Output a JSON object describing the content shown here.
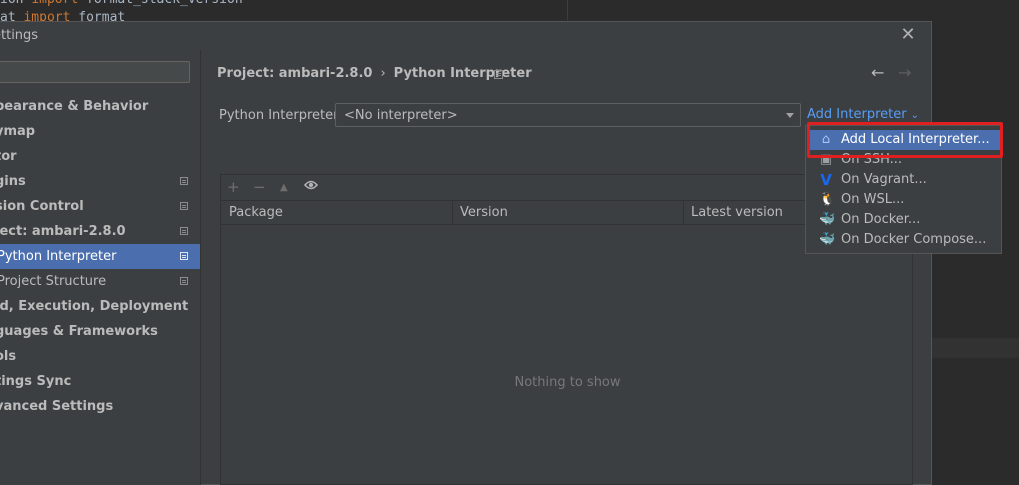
{
  "editor": {
    "line1": {
      "kw": "import",
      "pre": "ion ",
      "post": " format_stack_version"
    },
    "line2": {
      "kw": "import",
      "pre": "at ",
      "post": " format"
    }
  },
  "dialog": {
    "title": "ettings",
    "close_glyph": "✕"
  },
  "sidebar": {
    "items": [
      {
        "label": "pearance & Behavior",
        "bold": true,
        "doc": false
      },
      {
        "label": "ymap",
        "bold": true,
        "doc": false
      },
      {
        "label": "tor",
        "bold": true,
        "doc": false
      },
      {
        "label": "gins",
        "bold": true,
        "doc": true
      },
      {
        "label": "sion Control",
        "bold": true,
        "doc": true
      },
      {
        "label": "ject: ambari-2.8.0",
        "bold": true,
        "doc": true
      },
      {
        "label": "Python Interpreter",
        "bold": false,
        "doc": true,
        "selected": true
      },
      {
        "label": "Project Structure",
        "bold": false,
        "doc": true
      },
      {
        "label": "ld, Execution, Deployment",
        "bold": true,
        "doc": false
      },
      {
        "label": "guages & Frameworks",
        "bold": true,
        "doc": false
      },
      {
        "label": "ols",
        "bold": true,
        "doc": false
      },
      {
        "label": "tings Sync",
        "bold": true,
        "doc": false
      },
      {
        "label": "vanced Settings",
        "bold": true,
        "doc": false
      }
    ]
  },
  "breadcrumb": {
    "project": "Project: ambari-2.8.0",
    "sep": "›",
    "page": "Python Interpreter"
  },
  "nav": {
    "back": "←",
    "forward": "→"
  },
  "interpreter": {
    "label": "Python Interpreter:",
    "value": "<No interpreter>",
    "add_label": "Add Interpreter",
    "add_chevron": "⌄"
  },
  "packages": {
    "toolbar": {
      "add": "+",
      "remove": "−",
      "up": "▲",
      "eye": "👁"
    },
    "columns": [
      "Package",
      "Version",
      "Latest version"
    ],
    "empty_text": "Nothing to show"
  },
  "popup": {
    "items": [
      {
        "label": "Add Local Interpreter...",
        "icon": "home-icon",
        "glyph": "⌂",
        "color": "#a9c4f5",
        "highlighted": true
      },
      {
        "label": "On SSH...",
        "icon": "ssh-icon",
        "glyph": "▣",
        "color": "#9aa0a6"
      },
      {
        "label": "On Vagrant...",
        "icon": "vagrant-icon",
        "glyph": "V",
        "color": "#1868f2"
      },
      {
        "label": "On WSL...",
        "icon": "linux-penguin-icon",
        "glyph": "🐧",
        "color": "#e8e8e8"
      },
      {
        "label": "On Docker...",
        "icon": "docker-icon",
        "glyph": "🐳",
        "color": "#2496ed"
      },
      {
        "label": "On Docker Compose...",
        "icon": "docker-compose-icon",
        "glyph": "🐳",
        "color": "#2496ed"
      }
    ]
  },
  "colors": {
    "accent": "#4b6eaf",
    "link": "#589df6",
    "highlight_border": "#e02020"
  }
}
